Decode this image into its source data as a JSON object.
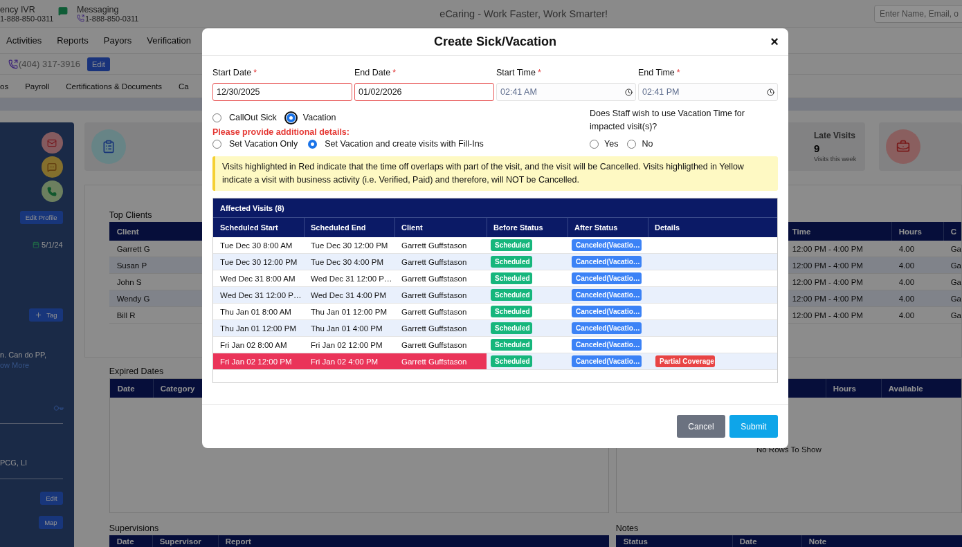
{
  "header": {
    "ivr_label": "ency IVR",
    "ivr_phone": "1-888-850-0311",
    "messaging_label": "Messaging",
    "messaging_phone": "1-888-850-0311",
    "title": "eCaring - Work Faster, Work Smarter!",
    "search": {
      "placeholder": "Enter Name, Email, o"
    }
  },
  "nav": [
    "Activities",
    "Reports",
    "Payors",
    "Verification"
  ],
  "contact": {
    "phone": "(404) 317-3916",
    "edit_button": "Edit"
  },
  "tabs": [
    "os",
    "Payroll",
    "Certifications & Documents",
    "Ca"
  ],
  "sidebar": {
    "edit_profile": "Edit Profile",
    "date": "5/1/24",
    "tag_button": "Tag",
    "note": "n. Can do PP,",
    "show_more": "ow More",
    "languages": "PCG, LI",
    "edit_button": "Edit",
    "map_button": "Map"
  },
  "late_visits": {
    "title": "Late Visits",
    "value": "9",
    "subtitle": "Visits this week"
  },
  "top_clients": {
    "title": "Top Clients",
    "columns": [
      "Client",
      "Time",
      "Hours",
      "C"
    ],
    "rows": [
      [
        "Garrett G",
        "12:00 PM - 4:00 PM",
        "4.00",
        "Ga"
      ],
      [
        "Susan P",
        "12:00 PM - 4:00 PM",
        "4.00",
        "Ga"
      ],
      [
        "John S",
        "12:00 PM - 4:00 PM",
        "4.00",
        "Ga"
      ],
      [
        "Wendy G",
        "12:00 PM - 4:00 PM",
        "4.00",
        "Ga"
      ],
      [
        "Bill R",
        "12:00 PM - 4:00 PM",
        "4.00",
        "Ga"
      ]
    ]
  },
  "expired_dates": {
    "title": "Expired Dates",
    "columns": [
      "Date",
      "Category"
    ]
  },
  "availability": {
    "columns": [
      "Hours",
      "Available"
    ],
    "empty": "No Rows To Show"
  },
  "supervisions": {
    "title": "Supervisions",
    "columns": [
      "Date",
      "Supervisor",
      "Report"
    ]
  },
  "notes": {
    "title": "Notes",
    "columns": [
      "Status",
      "Date",
      "Note"
    ]
  },
  "modal": {
    "title": "Create Sick/Vacation",
    "close": "×",
    "fields": [
      {
        "label": "Start Date",
        "required_mark": "*",
        "kind": "date",
        "value": "12/30/2025",
        "invalid": true
      },
      {
        "label": "End Date",
        "required_mark": "*",
        "kind": "date",
        "value": "01/02/2026",
        "invalid": true
      },
      {
        "label": "Start Time",
        "required_mark": "*",
        "kind": "time",
        "value": "02:41 AM",
        "invalid": false
      },
      {
        "label": "End Time",
        "required_mark": "*",
        "kind": "time",
        "value": "02:41 PM",
        "invalid": false
      }
    ],
    "leave_types": [
      {
        "label": "CallOut Sick",
        "selected": false,
        "focused": false
      },
      {
        "label": "Vacation",
        "selected": true,
        "focused": true
      }
    ],
    "details_prompt": "Please provide additional details:",
    "detail_options": [
      {
        "label": "Set Vacation Only",
        "selected": false
      },
      {
        "label": "Set Vacation and create visits with Fill-Ins",
        "selected": true
      }
    ],
    "question": "Does Staff wish to use Vacation Time for impacted visit(s)?",
    "answers": [
      {
        "label": "Yes",
        "selected": false
      },
      {
        "label": "No",
        "selected": false
      }
    ],
    "notice": "Visits highlighted in Red indicate that the time off overlaps with part of the visit, and the visit will be Cancelled. Visits highligthed in Yellow indicate a visit with business activity (i.e. Verified, Paid) and therefore, will NOT be Cancelled.",
    "table": {
      "title": "Affected Visits (8)",
      "columns": [
        "Scheduled Start",
        "Scheduled End",
        "Client",
        "Before Status",
        "After Status",
        "Details"
      ],
      "rows": [
        {
          "start": "Tue Dec 30 8:00 AM",
          "end": "Tue Dec 30 12:00 PM",
          "client": "Garrett Guffstason",
          "before_status": "Scheduled",
          "after_status": "Canceled(Vacatio…",
          "highlighted": false
        },
        {
          "start": "Tue Dec 30 12:00 PM",
          "end": "Tue Dec 30 4:00 PM",
          "client": "Garrett Guffstason",
          "before_status": "Scheduled",
          "after_status": "Canceled(Vacatio…",
          "highlighted": false
        },
        {
          "start": "Wed Dec 31 8:00 AM",
          "end": "Wed Dec 31 12:00 P…",
          "client": "Garrett Guffstason",
          "before_status": "Scheduled",
          "after_status": "Canceled(Vacatio…",
          "highlighted": false
        },
        {
          "start": "Wed Dec 31 12:00 P…",
          "end": "Wed Dec 31 4:00 PM",
          "client": "Garrett Guffstason",
          "before_status": "Scheduled",
          "after_status": "Canceled(Vacatio…",
          "highlighted": false
        },
        {
          "start": "Thu Jan 01 8:00 AM",
          "end": "Thu Jan 01 12:00 PM",
          "client": "Garrett Guffstason",
          "before_status": "Scheduled",
          "after_status": "Canceled(Vacatio…",
          "highlighted": false
        },
        {
          "start": "Thu Jan 01 12:00 PM",
          "end": "Thu Jan 01 4:00 PM",
          "client": "Garrett Guffstason",
          "before_status": "Scheduled",
          "after_status": "Canceled(Vacatio…",
          "highlighted": false
        },
        {
          "start": "Fri Jan 02 8:00 AM",
          "end": "Fri Jan 02 12:00 PM",
          "client": "Garrett Guffstason",
          "before_status": "Scheduled",
          "after_status": "Canceled(Vacatio…",
          "highlighted": false
        },
        {
          "start": "Fri Jan 02 12:00 PM",
          "end": "Fri Jan 02 4:00 PM",
          "client": "Garrett Guffstason",
          "before_status": "Scheduled",
          "after_status": "Canceled(Vacatio…",
          "details": "Partial Coverage",
          "highlighted": true
        }
      ]
    },
    "buttons": [
      {
        "label": "Cancel",
        "kind": "secondary"
      },
      {
        "label": "Submit",
        "kind": "primary"
      }
    ]
  }
}
